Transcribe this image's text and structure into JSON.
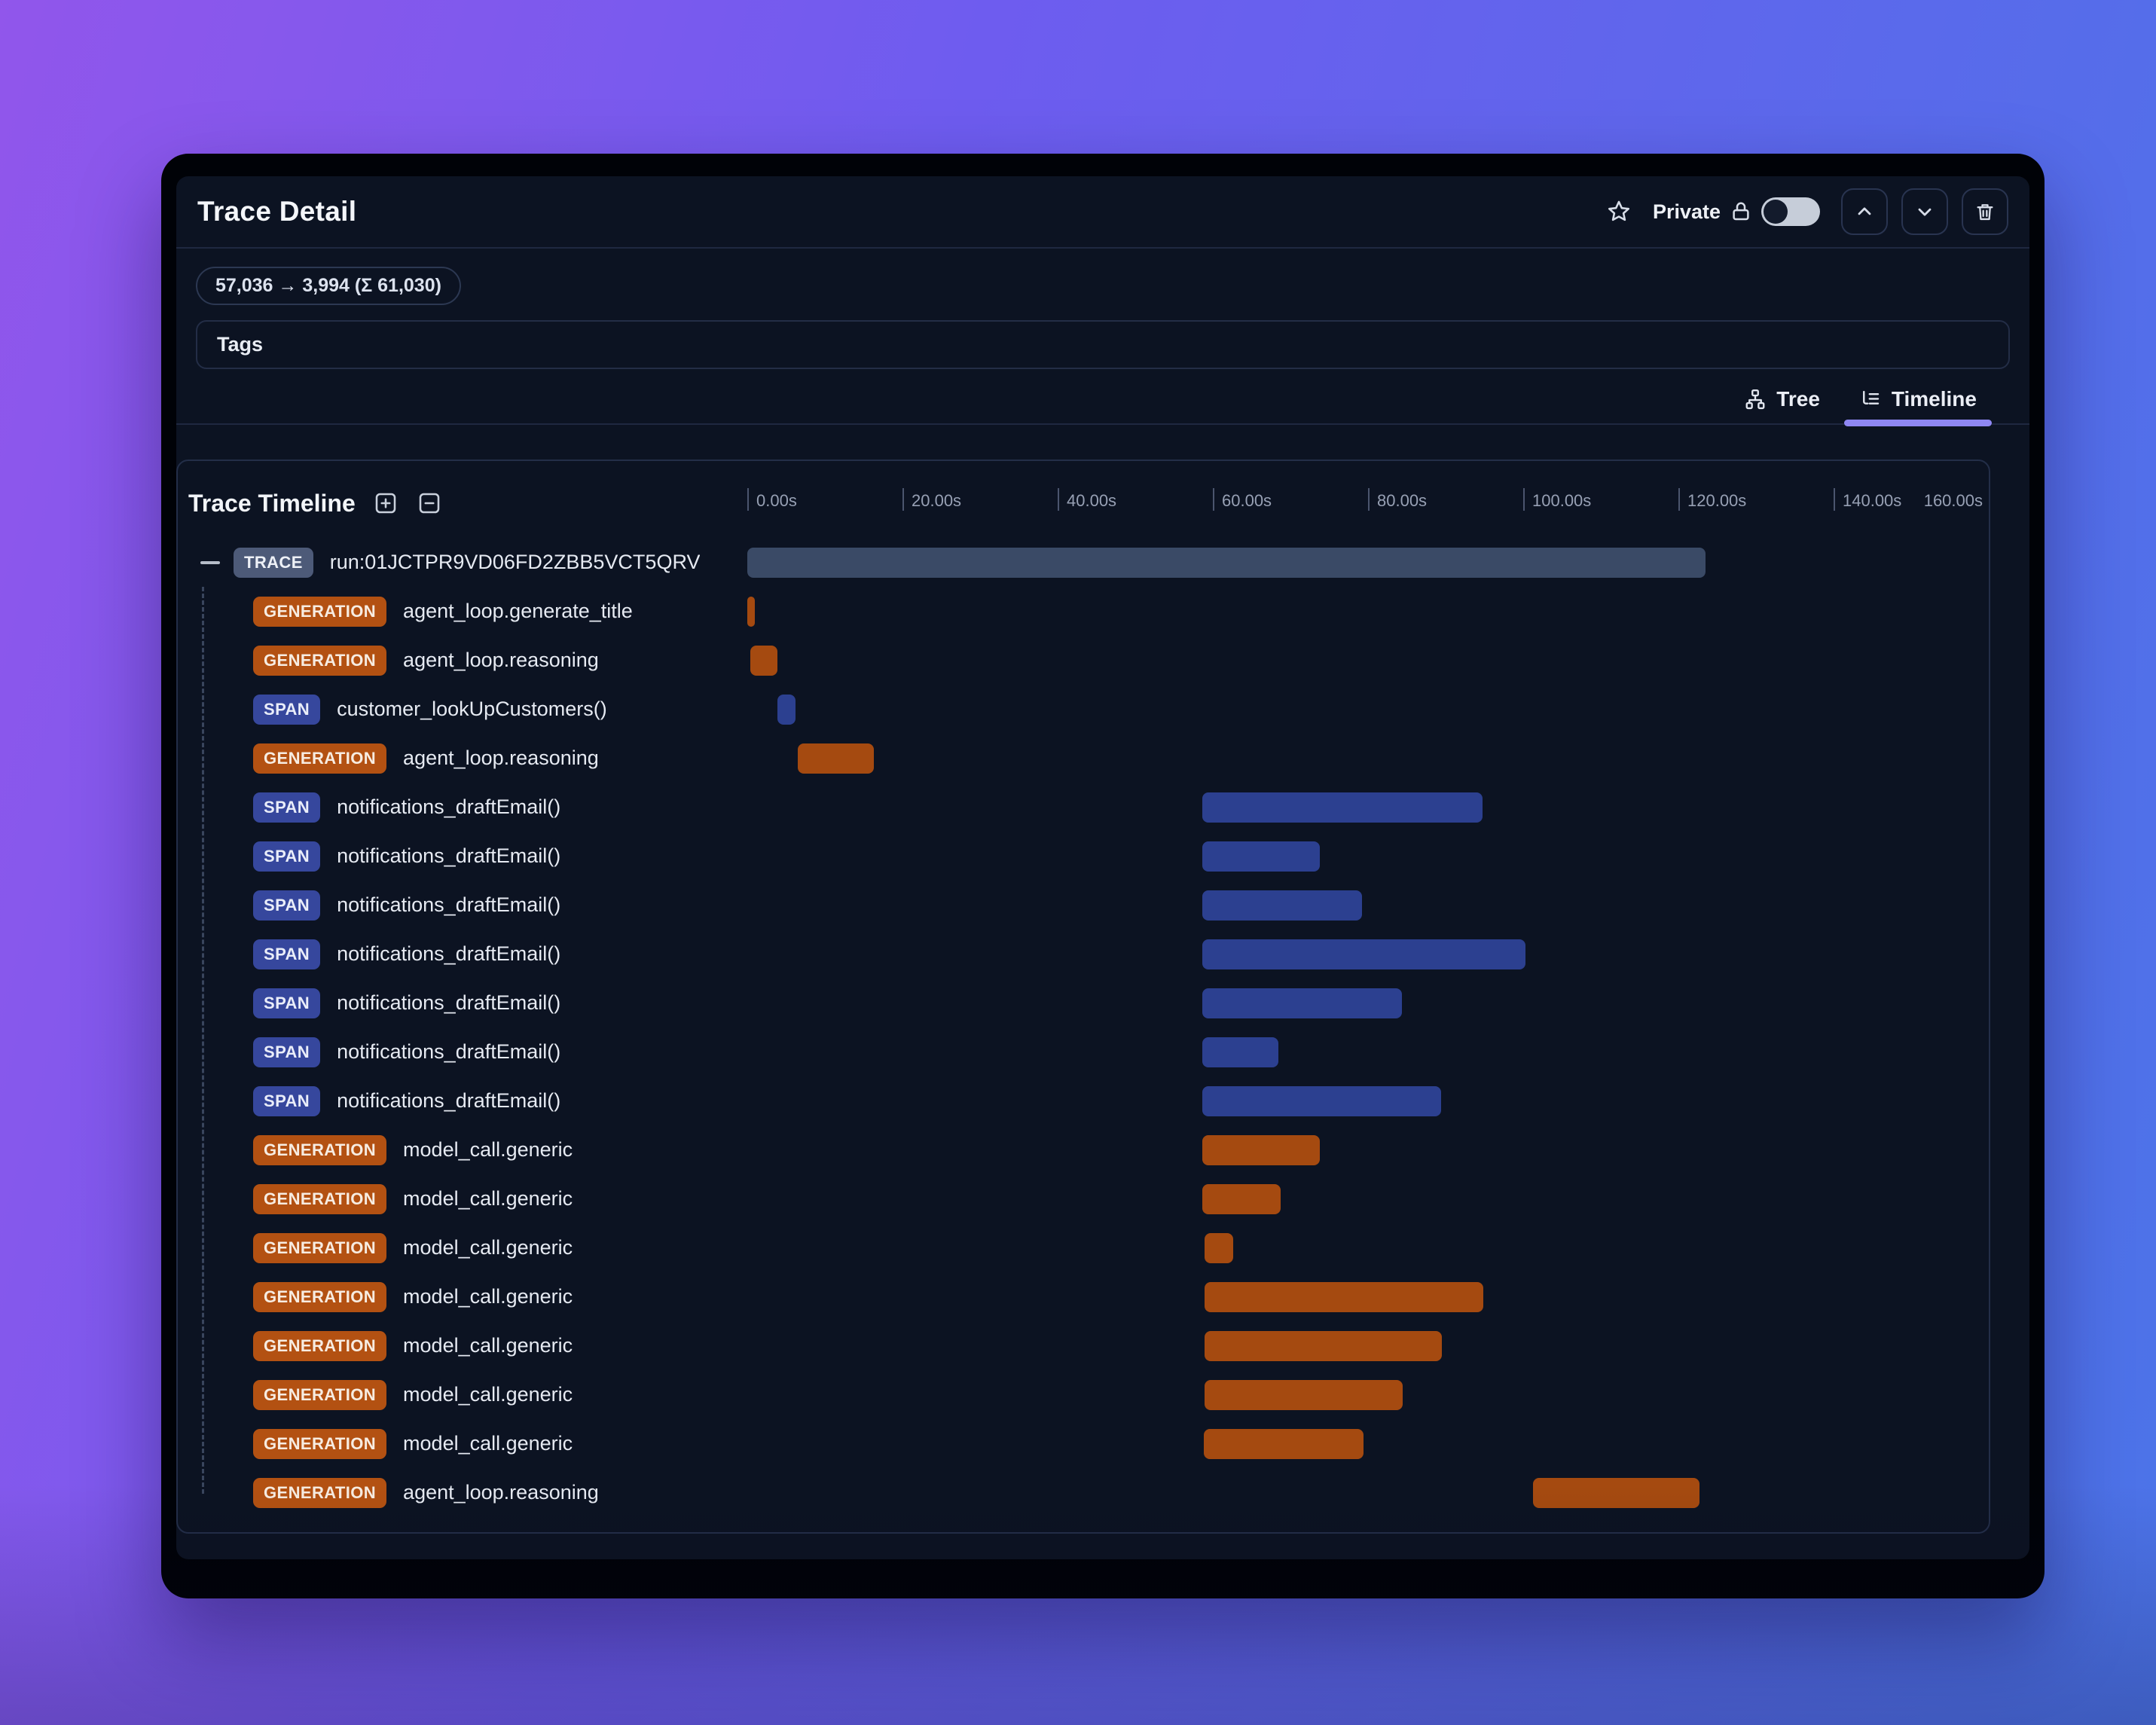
{
  "app": {
    "title": "Trace Detail"
  },
  "header": {
    "privacy_label": "Private",
    "privacy_toggle_state": "off"
  },
  "summary": {
    "token_badge": "57,036 → 3,994 (Σ 61,030)"
  },
  "tags": {
    "label": "Tags"
  },
  "view_tabs": [
    {
      "id": "tree",
      "label": "Tree",
      "active": false
    },
    {
      "id": "timeline",
      "label": "Timeline",
      "active": true
    }
  ],
  "timeline_panel": {
    "title": "Trace Timeline",
    "axis": {
      "tick_labels": [
        "0.00s",
        "20.00s",
        "40.00s",
        "60.00s",
        "80.00s",
        "100.00s",
        "120.00s",
        "140.00s"
      ],
      "end_label": "160.00s",
      "domain_seconds": 160
    },
    "rows": [
      {
        "type": "TRACE",
        "label": "run:01JCTPR9VD06FD2ZBB5VCT5QRV",
        "start_s": 0,
        "end_s": 123.5
      },
      {
        "type": "GENERATION",
        "label": "agent_loop.generate_title",
        "start_s": 0,
        "end_s": 1.0
      },
      {
        "type": "GENERATION",
        "label": "agent_loop.reasoning",
        "start_s": 0.35,
        "end_s": 3.9
      },
      {
        "type": "SPAN",
        "label": "customer_lookUpCustomers()",
        "start_s": 3.85,
        "end_s": 6.2
      },
      {
        "type": "GENERATION",
        "label": "agent_loop.reasoning",
        "start_s": 6.5,
        "end_s": 16.3
      },
      {
        "type": "SPAN",
        "label": "notifications_draftEmail()",
        "start_s": 58.6,
        "end_s": 94.8
      },
      {
        "type": "SPAN",
        "label": "notifications_draftEmail()",
        "start_s": 58.6,
        "end_s": 73.8
      },
      {
        "type": "SPAN",
        "label": "notifications_draftEmail()",
        "start_s": 58.6,
        "end_s": 79.2
      },
      {
        "type": "SPAN",
        "label": "notifications_draftEmail()",
        "start_s": 58.6,
        "end_s": 100.3
      },
      {
        "type": "SPAN",
        "label": "notifications_draftEmail()",
        "start_s": 58.6,
        "end_s": 84.4
      },
      {
        "type": "SPAN",
        "label": "notifications_draftEmail()",
        "start_s": 58.6,
        "end_s": 68.4
      },
      {
        "type": "SPAN",
        "label": "notifications_draftEmail()",
        "start_s": 58.6,
        "end_s": 89.4
      },
      {
        "type": "GENERATION",
        "label": "model_call.generic",
        "start_s": 58.6,
        "end_s": 73.8
      },
      {
        "type": "GENERATION",
        "label": "model_call.generic",
        "start_s": 58.6,
        "end_s": 68.7
      },
      {
        "type": "GENERATION",
        "label": "model_call.generic",
        "start_s": 58.9,
        "end_s": 62.6
      },
      {
        "type": "GENERATION",
        "label": "model_call.generic",
        "start_s": 58.9,
        "end_s": 94.9
      },
      {
        "type": "GENERATION",
        "label": "model_call.generic",
        "start_s": 58.9,
        "end_s": 89.5
      },
      {
        "type": "GENERATION",
        "label": "model_call.generic",
        "start_s": 58.9,
        "end_s": 84.5
      },
      {
        "type": "GENERATION",
        "label": "model_call.generic",
        "start_s": 58.8,
        "end_s": 79.4
      },
      {
        "type": "GENERATION",
        "label": "agent_loop.reasoning",
        "start_s": 101.3,
        "end_s": 122.7
      }
    ]
  },
  "colors": {
    "accent_tab_underline": "#8f87f3",
    "badge_trace": "#4d5a78",
    "badge_generation": "#b35112",
    "badge_span": "#36479d",
    "bar_trace": "#3a4a66",
    "bar_generation": "#a54a10",
    "bar_span": "#2c4090",
    "background_gradient_from": "#9156eb",
    "background_gradient_to": "#4b74e8",
    "panel_background": "#0c1322"
  }
}
